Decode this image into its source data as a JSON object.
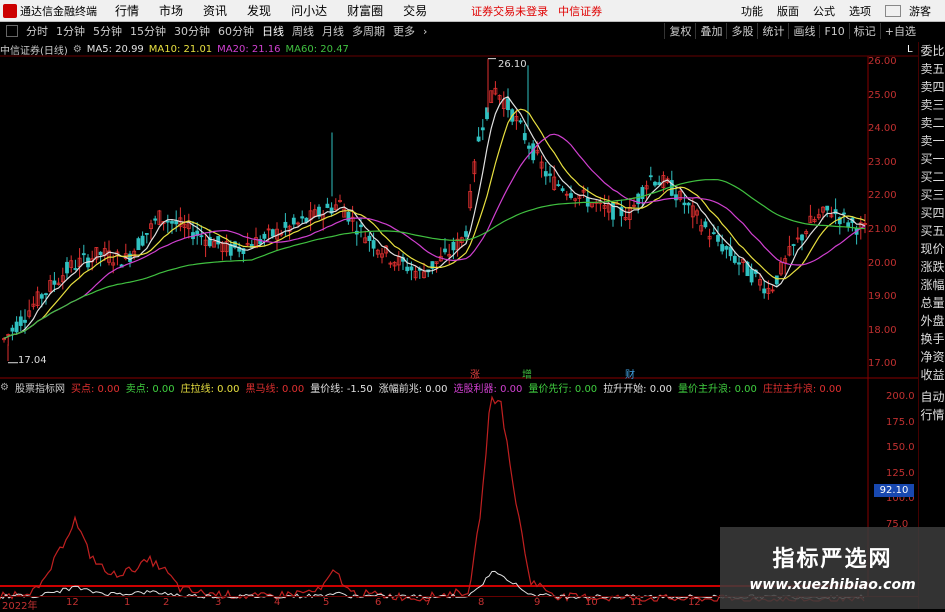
{
  "menubar": {
    "app_title": "通达信金融终端",
    "items": [
      "行情",
      "市场",
      "资讯",
      "发现",
      "问小达",
      "财富圈",
      "交易"
    ],
    "status": "证券交易未登录",
    "broker": "中信证券",
    "right_items": [
      "功能",
      "版面",
      "公式",
      "选项"
    ],
    "user": "游客"
  },
  "toolbar": {
    "periods": [
      "分时",
      "1分钟",
      "5分钟",
      "15分钟",
      "30分钟",
      "60分钟",
      "日线",
      "周线",
      "月线",
      "多周期",
      "更多"
    ],
    "active_period": "日线",
    "right_buttons": [
      "复权",
      "叠加",
      "多股",
      "统计",
      "画线",
      "F10",
      "标记",
      "+自选"
    ]
  },
  "main": {
    "stock_title": "中信证券(日线)",
    "ma": [
      {
        "label": "MA5: 20.99",
        "color": "#e0e0e0"
      },
      {
        "label": "MA10: 21.01",
        "color": "#e8e040"
      },
      {
        "label": "MA20: 21.16",
        "color": "#d040d0"
      },
      {
        "label": "MA60: 20.47",
        "color": "#40c040"
      }
    ],
    "y_ticks": [
      "26.00",
      "25.00",
      "24.00",
      "23.00",
      "22.00",
      "21.00",
      "20.00",
      "19.00",
      "18.00",
      "17.00"
    ],
    "high_label": "26.10",
    "low_label": "17.04",
    "corner_label": "L",
    "event_marks": [
      {
        "label": "涨",
        "color": "#e04040"
      },
      {
        "label": "增",
        "color": "#40c040"
      },
      {
        "label": "财",
        "color": "#40a0e0"
      }
    ]
  },
  "lower": {
    "indicator_name": "股票指标网",
    "items": [
      {
        "label": "买点: 0.00",
        "color": "#e03030"
      },
      {
        "label": "卖点: 0.00",
        "color": "#40d040"
      },
      {
        "label": "庄拉线: 0.00",
        "color": "#e8e040"
      },
      {
        "label": "黑马线: 0.00",
        "color": "#e03030"
      },
      {
        "label": "量价线: -1.50",
        "color": "#e0e0e0"
      },
      {
        "label": "涨幅前兆: 0.00",
        "color": "#e0e0e0"
      },
      {
        "label": "选股利器: 0.00",
        "color": "#d040d0"
      },
      {
        "label": "量价先行: 0.00",
        "color": "#40d040"
      },
      {
        "label": "拉升开始: 0.00",
        "color": "#e0e0e0"
      },
      {
        "label": "量价主升浪: 0.00",
        "color": "#40d040"
      },
      {
        "label": "庄拉主升浪: 0.00",
        "color": "#e03030"
      }
    ],
    "y_ticks": [
      "200.0",
      "175.0",
      "150.0",
      "125.0",
      "100.0",
      "75.0"
    ],
    "current_value": "92.10"
  },
  "xaxis": {
    "labels": [
      "2022年",
      "12",
      "1",
      "2",
      "3",
      "4",
      "5",
      "6",
      "7",
      "8",
      "9",
      "10",
      "11",
      "12"
    ]
  },
  "sidebar": {
    "items": [
      "委比",
      "卖五",
      "卖四",
      "卖三",
      "卖二",
      "卖一",
      "买一",
      "买二",
      "买三",
      "买四",
      "买五",
      "现价",
      "涨跌",
      "涨幅",
      "总量",
      "外盘",
      "换手",
      "净资",
      "收益",
      "自动",
      "行情"
    ]
  },
  "watermark": {
    "title": "指标严选网",
    "url": "www.xuezhibiao.com"
  }
}
